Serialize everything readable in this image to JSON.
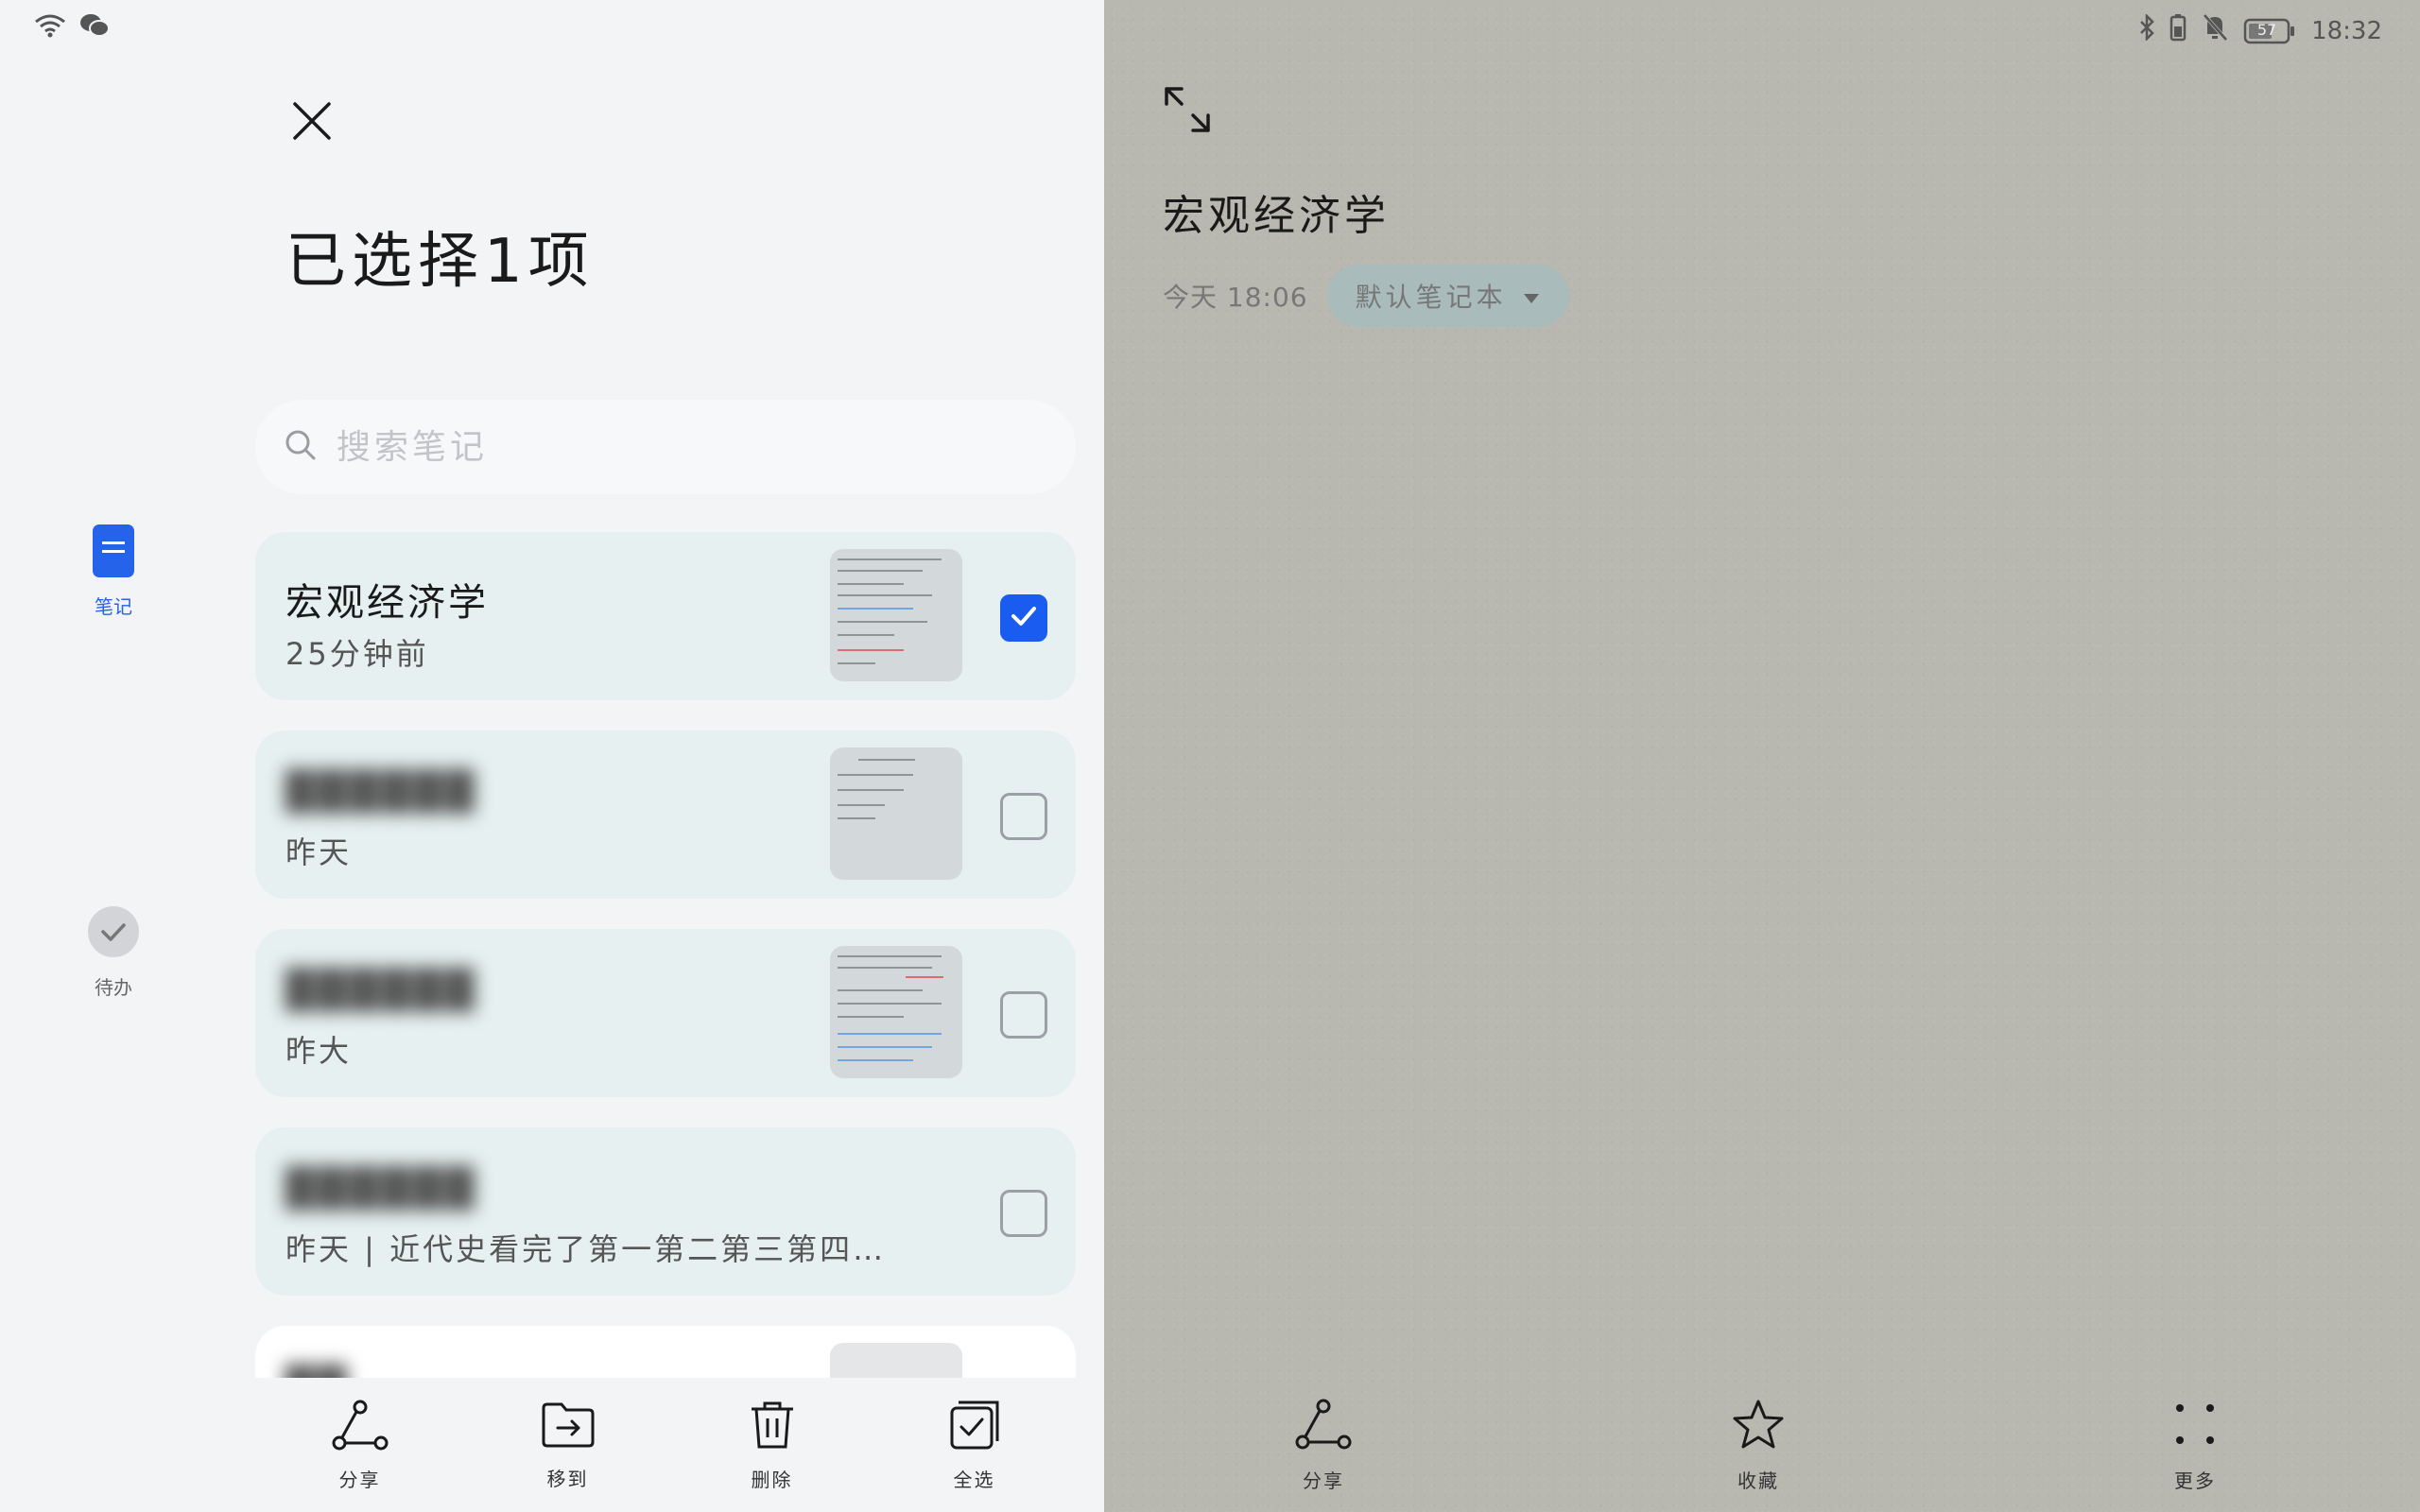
{
  "status": {
    "time": "18:32",
    "battery": "57",
    "left_icons": [
      "wifi-icon",
      "wechat-icon"
    ],
    "right_icons": [
      "bluetooth-icon",
      "battery-saver-icon",
      "mute-icon",
      "battery-icon"
    ]
  },
  "rail": {
    "notes_label": "笔记",
    "todo_label": "待办"
  },
  "header": {
    "title": "已选择1项"
  },
  "search": {
    "placeholder": "搜索笔记"
  },
  "notes": [
    {
      "title": "宏观经济学",
      "subtitle": "25分钟前",
      "checked": true,
      "has_thumb": true,
      "blurred": false
    },
    {
      "title": "██████",
      "subtitle": "昨天",
      "checked": false,
      "has_thumb": true,
      "blurred": true
    },
    {
      "title": "██████",
      "subtitle": "昨大",
      "checked": false,
      "has_thumb": true,
      "blurred": true
    },
    {
      "title": "██████",
      "subtitle": "昨天 | 近代史看完了第一第二第三第四…",
      "checked": false,
      "has_thumb": false,
      "blurred": true
    },
    {
      "title": "██",
      "subtitle": "",
      "checked": false,
      "has_thumb": true,
      "blurred": true
    }
  ],
  "bottom_bar": {
    "share": "分享",
    "move": "移到",
    "delete": "删除",
    "select_all": "全选"
  },
  "detail": {
    "title": "宏观经济学",
    "time": "今天 18:06",
    "notebook": "默认笔记本",
    "share": "分享",
    "favorite": "收藏",
    "more": "更多"
  },
  "colors": {
    "accent": "#1a5cf0",
    "card_bg": "#e6f0f0",
    "right_bg": "#b8b8b0"
  }
}
